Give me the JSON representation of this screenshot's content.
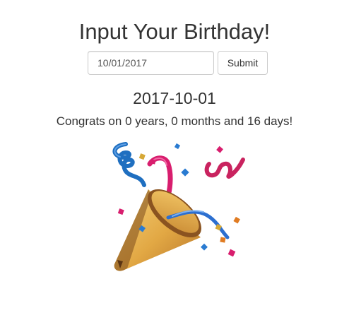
{
  "header": {
    "title": "Input Your Birthday!"
  },
  "form": {
    "date_value": "10/01/2017",
    "submit_label": "Submit"
  },
  "result": {
    "date": "2017-10-01",
    "message": "Congrats on 0 years, 0 months and 16 days!"
  },
  "image": {
    "icon": "party-popper-icon",
    "colors": {
      "cone": "#e8b04a",
      "cone_dark": "#b7752a",
      "streamer_blue": "#1f6fc0",
      "streamer_pink": "#d81e6e"
    }
  }
}
